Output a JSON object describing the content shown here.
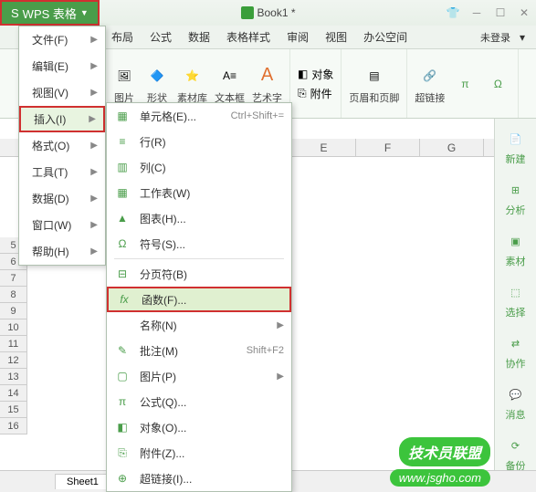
{
  "titlebar": {
    "app_name": "WPS 表格",
    "doc_title": "Book1 *"
  },
  "menubar": {
    "items": [
      "布局",
      "公式",
      "数据",
      "表格样式",
      "审阅",
      "视图",
      "办公空间"
    ],
    "login": "未登录"
  },
  "ribbon": {
    "picture": "图片",
    "shape": "形状",
    "material": "素材库",
    "textbox": "文本框",
    "wordart": "艺术字",
    "object": "对象",
    "attachment": "附件",
    "header_footer": "页眉和页脚",
    "hyperlink": "超链接"
  },
  "main_menu": {
    "items": [
      {
        "label": "文件(F)",
        "arrow": true
      },
      {
        "label": "编辑(E)",
        "arrow": true
      },
      {
        "label": "视图(V)",
        "arrow": true
      },
      {
        "label": "插入(I)",
        "arrow": true,
        "highlighted": true
      },
      {
        "label": "格式(O)",
        "arrow": true
      },
      {
        "label": "工具(T)",
        "arrow": true
      },
      {
        "label": "数据(D)",
        "arrow": true
      },
      {
        "label": "窗口(W)",
        "arrow": true
      },
      {
        "label": "帮助(H)",
        "arrow": true
      }
    ]
  },
  "sub_menu": {
    "items": [
      {
        "icon": "cells-icon",
        "glyph": "▦",
        "label": "单元格(E)...",
        "shortcut": "Ctrl+Shift+="
      },
      {
        "icon": "row-icon",
        "glyph": "≡",
        "label": "行(R)"
      },
      {
        "icon": "column-icon",
        "glyph": "▥",
        "label": "列(C)"
      },
      {
        "icon": "sheet-icon",
        "glyph": "▦",
        "label": "工作表(W)"
      },
      {
        "icon": "chart-icon",
        "glyph": "▲",
        "label": "图表(H)..."
      },
      {
        "icon": "symbol-icon",
        "glyph": "Ω",
        "label": "符号(S)..."
      },
      {
        "sep": true
      },
      {
        "icon": "pagebreak-icon",
        "glyph": "⊟",
        "label": "分页符(B)"
      },
      {
        "icon": "function-icon",
        "glyph": "fx",
        "label": "函数(F)...",
        "highlighted": true
      },
      {
        "icon": "name-icon",
        "glyph": "",
        "label": "名称(N)",
        "arrow": true
      },
      {
        "icon": "comment-icon",
        "glyph": "✎",
        "label": "批注(M)",
        "shortcut": "Shift+F2"
      },
      {
        "icon": "picture-icon",
        "glyph": "▢",
        "label": "图片(P)",
        "arrow": true
      },
      {
        "icon": "formula-icon",
        "glyph": "π",
        "label": "公式(Q)..."
      },
      {
        "icon": "object-icon",
        "glyph": "◧",
        "label": "对象(O)..."
      },
      {
        "icon": "attachment-icon",
        "glyph": "⎘",
        "label": "附件(Z)..."
      },
      {
        "icon": "hyperlink-icon",
        "glyph": "⊕",
        "label": "超链接(I)..."
      }
    ]
  },
  "grid": {
    "columns": [
      "E",
      "F",
      "G"
    ],
    "rows": [
      5,
      6,
      7,
      8,
      9,
      10,
      11,
      12,
      13,
      14,
      15,
      16
    ]
  },
  "side_panel": {
    "items": [
      {
        "icon": "new-icon",
        "label": "新建"
      },
      {
        "icon": "analyze-icon",
        "label": "分析"
      },
      {
        "icon": "material-icon",
        "label": "素材"
      },
      {
        "icon": "select-icon",
        "label": "选择"
      },
      {
        "icon": "collab-icon",
        "label": "协作"
      },
      {
        "icon": "message-icon",
        "label": "消息"
      },
      {
        "icon": "backup-icon",
        "label": "备份"
      }
    ]
  },
  "sheet_tabs": {
    "active": "Sheet1"
  },
  "watermarks": {
    "word_union": "联盟",
    "tech_union": "技术员联盟",
    "url": "www.jsgho.com"
  }
}
